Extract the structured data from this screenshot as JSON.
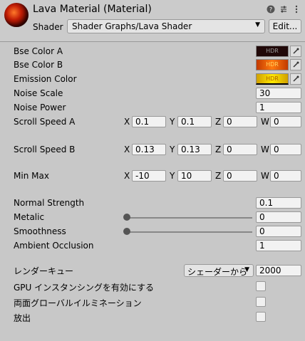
{
  "header": {
    "title": "Lava Material (Material)",
    "shader_label": "Shader",
    "shader_value": "Shader Graphs/Lava Shader",
    "edit_button": "Edit..."
  },
  "properties": {
    "base_color_a": {
      "label": "Bse Color A",
      "hdr": "HDR",
      "color": "#200808"
    },
    "base_color_b": {
      "label": "Bse Color B",
      "hdr": "HDR",
      "color": "#ff7a10"
    },
    "emission_color": {
      "label": "Emission Color",
      "hdr": "HDR",
      "color": "#ffe800"
    },
    "noise_scale": {
      "label": "Noise Scale",
      "value": "30"
    },
    "noise_power": {
      "label": "Noise Power",
      "value": "1"
    },
    "scroll_speed_a": {
      "label": "Scroll Speed A",
      "x": "0.1",
      "y": "0.1",
      "z": "0",
      "w": "0"
    },
    "scroll_speed_b": {
      "label": "Scroll Speed B",
      "x": "0.13",
      "y": "0.13",
      "z": "0",
      "w": "0"
    },
    "min_max": {
      "label": "Min Max",
      "x": "-10",
      "y": "10",
      "z": "0",
      "w": "0"
    },
    "normal_strength": {
      "label": "Normal Strength",
      "value": "0.1"
    },
    "metalic": {
      "label": "Metalic",
      "value": "0"
    },
    "smoothness": {
      "label": "Smoothness",
      "value": "0"
    },
    "ambient_occlusion": {
      "label": "Ambient Occlusion",
      "value": "1"
    }
  },
  "axis_labels": {
    "x": "X",
    "y": "Y",
    "z": "Z",
    "w": "W"
  },
  "advanced": {
    "render_queue": {
      "label": "レンダーキュー",
      "dropdown": "シェーダーから",
      "value": "2000"
    },
    "gpu_instancing": {
      "label": "GPU インスタンシングを有効にする",
      "checked": false
    },
    "double_sided_gi": {
      "label": "両面グローバルイルミネーション",
      "checked": false
    },
    "emission": {
      "label": "放出",
      "checked": false
    }
  },
  "icons": [
    "material-thumbnail-icon",
    "help-icon",
    "preset-icon",
    "more-menu-icon",
    "dropdown-arrow-icon",
    "eyedropper-icon"
  ]
}
